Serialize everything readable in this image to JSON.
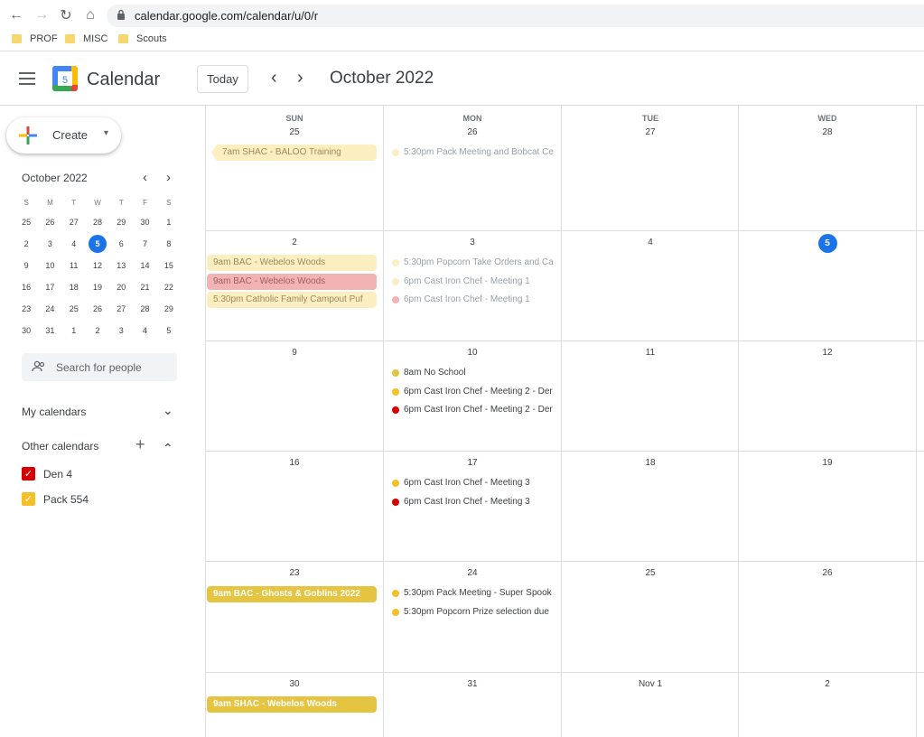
{
  "browser": {
    "url": "calendar.google.com/calendar/u/0/r",
    "bookmarks": [
      "PROF",
      "MISC",
      "Scouts"
    ]
  },
  "header": {
    "app_name": "Calendar",
    "logo_day": "5",
    "today_label": "Today",
    "month_title": "October 2022"
  },
  "sidebar": {
    "create_label": "Create",
    "mini_calendar": {
      "title": "October 2022",
      "weekdays": [
        "S",
        "M",
        "T",
        "W",
        "T",
        "F",
        "S"
      ],
      "weeks": [
        [
          "25",
          "26",
          "27",
          "28",
          "29",
          "30",
          "1"
        ],
        [
          "2",
          "3",
          "4",
          "5",
          "6",
          "7",
          "8"
        ],
        [
          "9",
          "10",
          "11",
          "12",
          "13",
          "14",
          "15"
        ],
        [
          "16",
          "17",
          "18",
          "19",
          "20",
          "21",
          "22"
        ],
        [
          "23",
          "24",
          "25",
          "26",
          "27",
          "28",
          "29"
        ],
        [
          "30",
          "31",
          "1",
          "2",
          "3",
          "4",
          "5"
        ]
      ],
      "today": "5"
    },
    "search_placeholder": "Search for people",
    "my_calendars_label": "My calendars",
    "other_calendars_label": "Other calendars",
    "calendars": [
      {
        "name": "Den 4",
        "color": "#d50000"
      },
      {
        "name": "Pack 554",
        "color": "#f6bf26"
      }
    ]
  },
  "grid": {
    "weekdays": [
      "SUN",
      "MON",
      "TUE",
      "WED"
    ],
    "weeks": [
      [
        "25",
        "26",
        "27",
        "28"
      ],
      [
        "2",
        "3",
        "4",
        "5"
      ],
      [
        "9",
        "10",
        "11",
        "12"
      ],
      [
        "16",
        "17",
        "18",
        "19"
      ],
      [
        "23",
        "24",
        "25",
        "26"
      ],
      [
        "30",
        "31",
        "Nov 1",
        "2"
      ]
    ],
    "events": {
      "w0_sun_1": "7am SHAC - BALOO Training",
      "w0_mon_1_time": "5:30pm",
      "w0_mon_1_title": "Pack Meeting and Bobcat Ce",
      "w1_sun_1": "9am BAC - Webelos Woods",
      "w1_sun_2": "9am BAC - Webelos Woods",
      "w1_sun_3": "5:30pm Catholic Family Campout Puf",
      "w1_mon_1_time": "5:30pm",
      "w1_mon_1_title": "Popcorn Take Orders and Ca",
      "w1_mon_2_time": "6pm",
      "w1_mon_2_title": "Cast Iron Chef - Meeting 1",
      "w1_mon_3_time": "6pm",
      "w1_mon_3_title": "Cast Iron Chef - Meeting 1",
      "w2_mon_1_time": "8am",
      "w2_mon_1_title": "No School",
      "w2_mon_2_time": "6pm",
      "w2_mon_2_title": "Cast Iron Chef - Meeting 2 - Der",
      "w2_mon_3_time": "6pm",
      "w2_mon_3_title": "Cast Iron Chef - Meeting 2 - Der",
      "w3_mon_1_time": "6pm",
      "w3_mon_1_title": "Cast Iron Chef - Meeting 3",
      "w3_mon_2_time": "6pm",
      "w3_mon_2_title": "Cast Iron Chef - Meeting 3",
      "w4_sun_1": "9am BAC - Ghosts & Goblins 2022",
      "w4_mon_1_time": "5:30pm",
      "w4_mon_1_title": "Pack Meeting - Super Spook",
      "w4_mon_2_time": "5:30pm",
      "w4_mon_2_title": "Popcorn Prize selection due",
      "w5_sun_1": "9am SHAC - Webelos Woods"
    }
  },
  "colors": {
    "today_blue": "#1a73e8",
    "pack_yellow": "#e4c441",
    "pack_yellow_past": "#fbefc2",
    "den_red": "#d50000",
    "den_red_past": "#f1b3b3"
  }
}
